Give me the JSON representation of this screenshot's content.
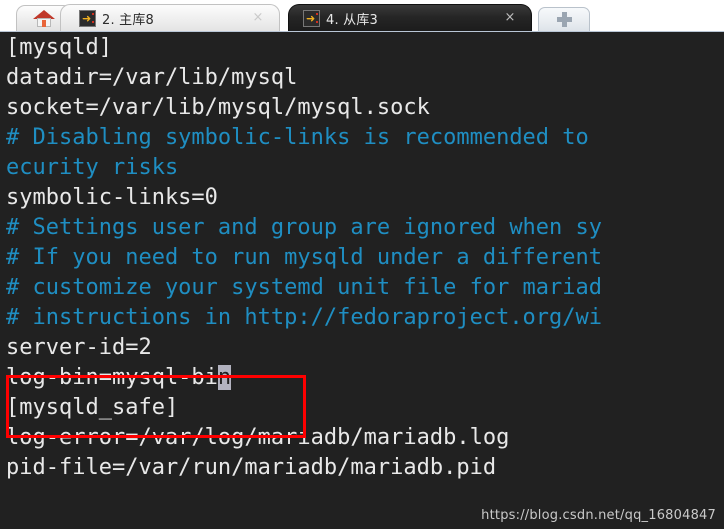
{
  "tabbar": {
    "home_tab": {
      "name": "home",
      "icon": "home-icon"
    },
    "tabs": [
      {
        "label": "2. 主库8",
        "icon": "key-icon",
        "close_label": "×",
        "active": false
      },
      {
        "label": "4. 从库3",
        "icon": "key-icon",
        "close_label": "×",
        "active": true
      }
    ],
    "new_tab": {
      "label": "+",
      "icon": "plus-icon"
    }
  },
  "terminal": {
    "background_color": "#212121",
    "comment_color": "#1f8ec2",
    "text_color": "#e8e8e8",
    "cursor_color": "#b2b2bf",
    "lines": [
      {
        "text": "[mysqld]",
        "type": "plain"
      },
      {
        "text": "datadir=/var/lib/mysql",
        "type": "plain"
      },
      {
        "text": "socket=/var/lib/mysql/mysql.sock",
        "type": "plain"
      },
      {
        "text": "# Disabling symbolic-links is recommended to",
        "type": "comment"
      },
      {
        "text": "ecurity risks",
        "type": "comment"
      },
      {
        "text": "symbolic-links=0",
        "type": "plain"
      },
      {
        "text": "# Settings user and group are ignored when sy",
        "type": "comment"
      },
      {
        "text": "# If you need to run mysqld under a different",
        "type": "comment"
      },
      {
        "text": "# customize your systemd unit file for mariad",
        "type": "comment"
      },
      {
        "text": "# instructions in http://fedoraproject.org/wi",
        "type": "comment"
      },
      {
        "text": "server-id=2",
        "type": "plain"
      },
      {
        "text": "log-bin=mysql-bi",
        "type": "plain",
        "cursor": "n"
      },
      {
        "text": "[mysqld_safe]",
        "type": "plain"
      },
      {
        "text": "log-error=/var/log/mariadb/mariadb.log",
        "type": "plain"
      },
      {
        "text": "pid-file=/var/run/mariadb/mariadb.pid",
        "type": "plain"
      }
    ]
  },
  "annotation": {
    "highlight_box_color": "#fe0000"
  },
  "watermark": {
    "text": "https://blog.csdn.net/qq_16804847"
  }
}
